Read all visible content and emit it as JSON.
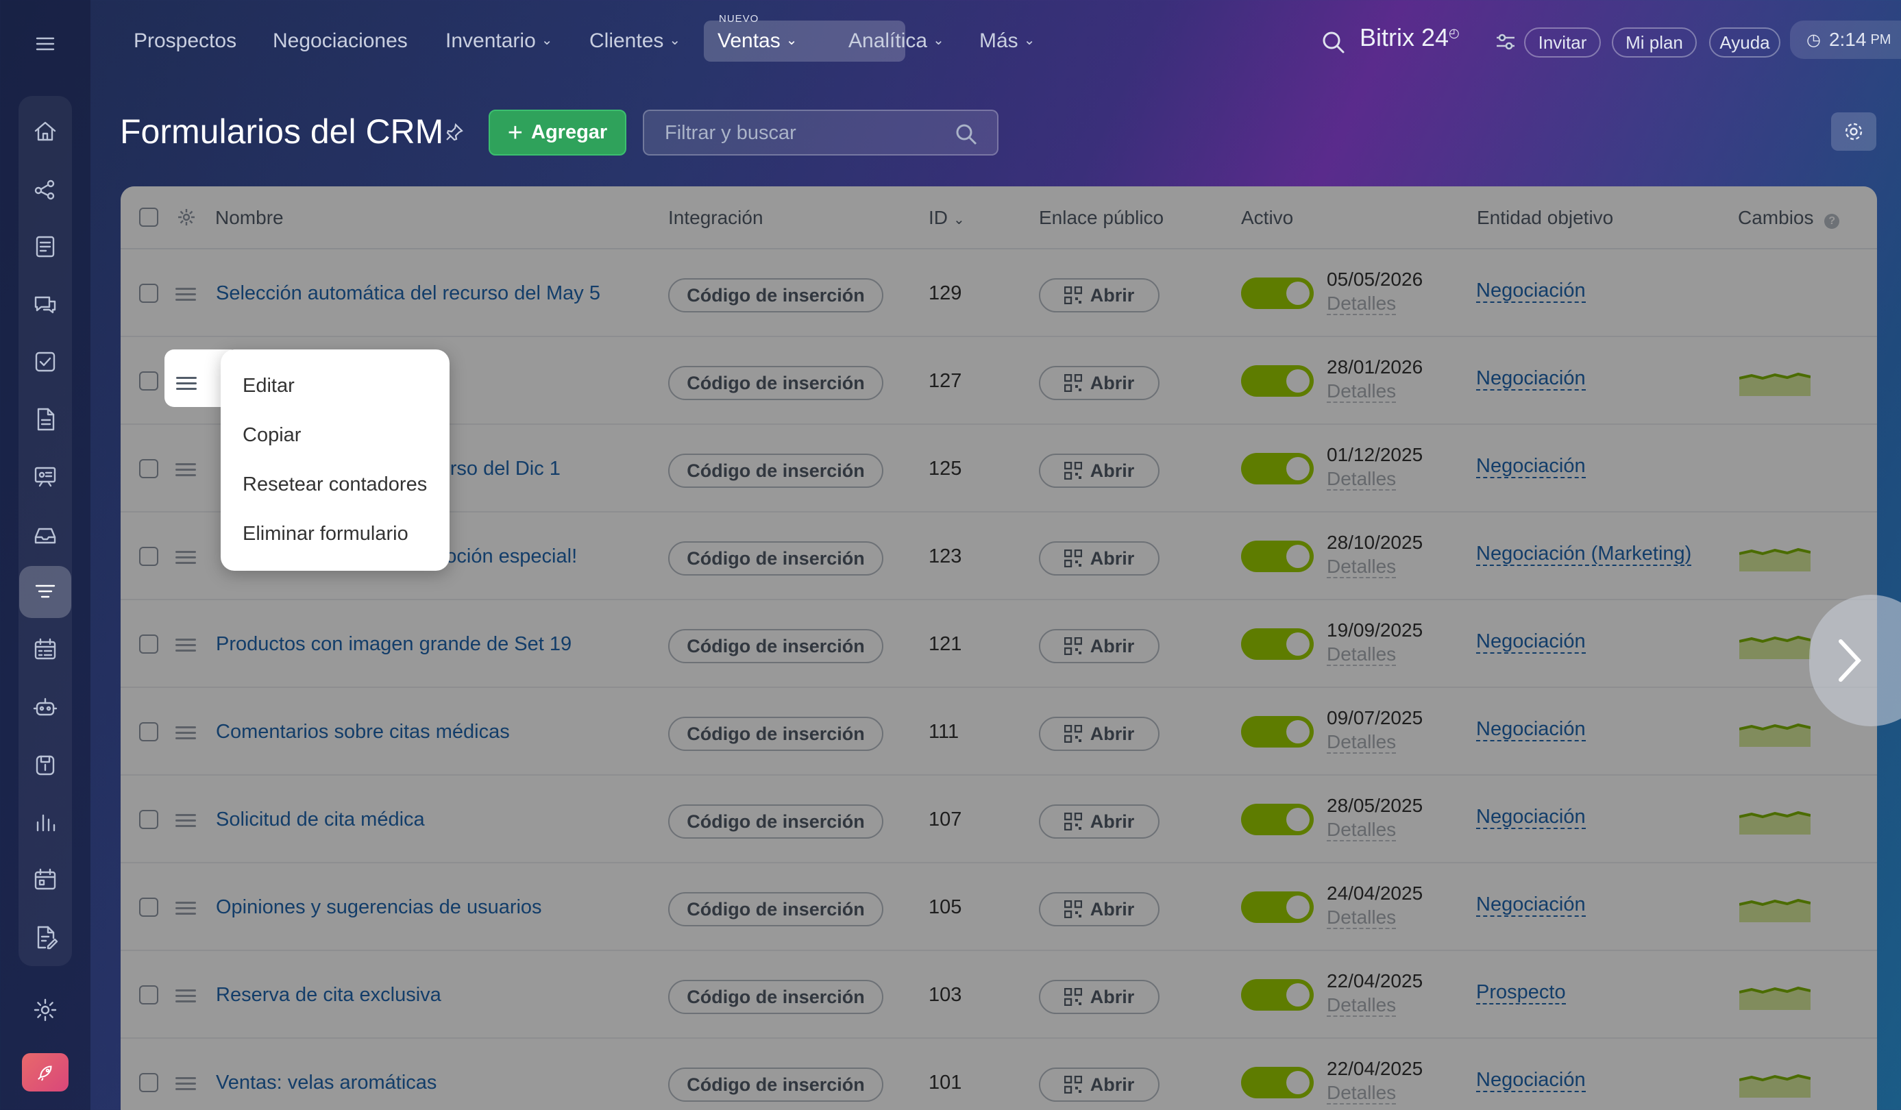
{
  "nav": {
    "items": [
      {
        "label": "Prospectos",
        "chevron": false
      },
      {
        "label": "Negociaciones",
        "chevron": false
      },
      {
        "label": "Inventario",
        "chevron": true
      },
      {
        "label": "Clientes",
        "chevron": true
      },
      {
        "label": "Ventas",
        "chevron": true,
        "active": true,
        "badge": "NUEVO"
      },
      {
        "label": "Analítica",
        "chevron": true
      },
      {
        "label": "Más",
        "chevron": true
      }
    ],
    "brand": "Bitrix 24",
    "invite": "Invitar",
    "plan": "Mi plan",
    "help": "Ayuda",
    "time": "2:14",
    "time_suffix": "PM"
  },
  "page": {
    "title": "Formularios del CRM",
    "add_label": "Agregar",
    "search_placeholder": "Filtrar y buscar"
  },
  "table": {
    "columns": {
      "name": "Nombre",
      "integration": "Integración",
      "id": "ID",
      "public_link": "Enlace público",
      "active": "Activo",
      "entity": "Entidad objetivo",
      "changes": "Cambios"
    },
    "rows": [
      {
        "name": "Selección automática del recurso del May 5",
        "integration": "Código de inserción",
        "id": "129",
        "open": "Abrir",
        "date": "05/05/2026",
        "details": "Detalles",
        "entity": "Negociación",
        "spark": false
      },
      {
        "name": "",
        "integration": "Código de inserción",
        "id": "127",
        "open": "Abrir",
        "date": "28/01/2026",
        "details": "Detalles",
        "entity": "Negociación",
        "spark": true
      },
      {
        "name": "ecurso del Dic 1",
        "integration": "Código de inserción",
        "id": "125",
        "open": "Abrir",
        "date": "01/12/2025",
        "details": "Detalles",
        "entity": "Negociación",
        "spark": false
      },
      {
        "name": "omoción especial!",
        "integration": "Código de inserción",
        "id": "123",
        "open": "Abrir",
        "date": "28/10/2025",
        "details": "Detalles",
        "entity": "Negociación (Marketing)",
        "spark": true
      },
      {
        "name": "Productos con imagen grande de Set 19",
        "integration": "Código de inserción",
        "id": "121",
        "open": "Abrir",
        "date": "19/09/2025",
        "details": "Detalles",
        "entity": "Negociación",
        "spark": true
      },
      {
        "name": "Comentarios sobre citas médicas",
        "integration": "Código de inserción",
        "id": "111",
        "open": "Abrir",
        "date": "09/07/2025",
        "details": "Detalles",
        "entity": "Negociación",
        "spark": true
      },
      {
        "name": "Solicitud de cita médica",
        "integration": "Código de inserción",
        "id": "107",
        "open": "Abrir",
        "date": "28/05/2025",
        "details": "Detalles",
        "entity": "Negociación",
        "spark": true
      },
      {
        "name": "Opiniones y sugerencias de usuarios",
        "integration": "Código de inserción",
        "id": "105",
        "open": "Abrir",
        "date": "24/04/2025",
        "details": "Detalles",
        "entity": "Negociación",
        "spark": true
      },
      {
        "name": "Reserva de cita exclusiva",
        "integration": "Código de inserción",
        "id": "103",
        "open": "Abrir",
        "date": "22/04/2025",
        "details": "Detalles",
        "entity": "Prospecto",
        "spark": true
      },
      {
        "name": "Ventas: velas aromáticas",
        "integration": "Código de inserción",
        "id": "101",
        "open": "Abrir",
        "date": "22/04/2025",
        "details": "Detalles",
        "entity": "Negociación",
        "spark": true
      }
    ]
  },
  "context_menu": {
    "items": [
      "Editar",
      "Copiar",
      "Resetear contadores",
      "Eliminar formulario"
    ]
  },
  "colors": {
    "add_button": "#2fa25b",
    "toggle_on": "#9dcf00",
    "link": "#2067b0"
  }
}
